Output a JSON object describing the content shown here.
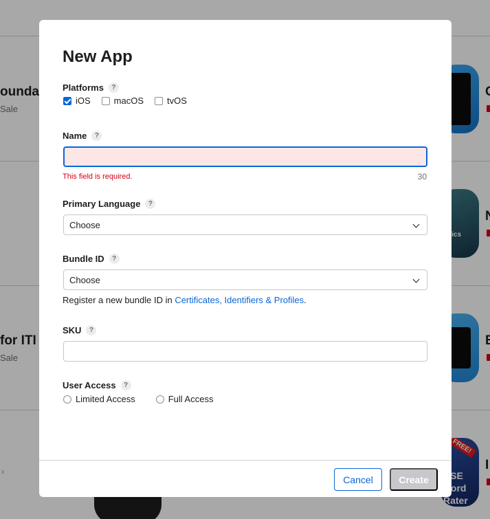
{
  "background": {
    "rows": [
      {
        "title": "ounda",
        "subtitle": "Sale"
      },
      {
        "title": "for ITI",
        "subtitle": "Sale"
      }
    ],
    "tiles": [
      {
        "text": ""
      },
      {
        "text": "o\nnics\np"
      },
      {
        "text": ""
      },
      {
        "ribbon": "FREE!",
        "text": "CSE\nword\nRater"
      }
    ],
    "edge_chars": [
      "C",
      "N",
      "E",
      "I"
    ],
    "chevron": "›"
  },
  "modal": {
    "title": "New App",
    "platforms": {
      "label": "Platforms",
      "help": "?",
      "options": [
        {
          "label": "iOS",
          "checked": true
        },
        {
          "label": "macOS",
          "checked": false
        },
        {
          "label": "tvOS",
          "checked": false
        }
      ]
    },
    "name": {
      "label": "Name",
      "help": "?",
      "value": "",
      "error": "This field is required.",
      "counter": "30"
    },
    "primary_language": {
      "label": "Primary Language",
      "help": "?",
      "selected": "Choose"
    },
    "bundle_id": {
      "label": "Bundle ID",
      "help": "?",
      "selected": "Choose",
      "hint_prefix": "Register a new bundle ID in ",
      "hint_link": "Certificates, Identifiers & Profiles",
      "hint_suffix": "."
    },
    "sku": {
      "label": "SKU",
      "help": "?",
      "value": ""
    },
    "user_access": {
      "label": "User Access",
      "help": "?",
      "options": [
        {
          "label": "Limited Access",
          "selected": false
        },
        {
          "label": "Full Access",
          "selected": false
        }
      ]
    },
    "buttons": {
      "cancel": "Cancel",
      "create": "Create"
    }
  },
  "colors": {
    "accent": "#0a66d8",
    "error": "#d70015",
    "error_bg": "#fde6e6",
    "disabled_button": "#c7c7cc"
  }
}
